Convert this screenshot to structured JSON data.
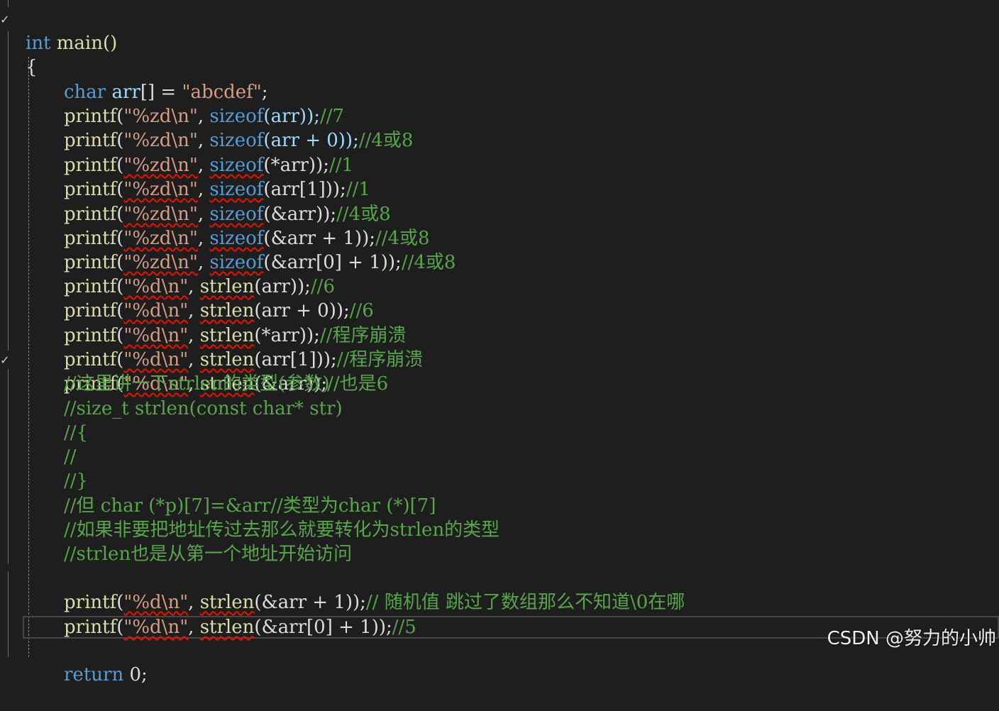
{
  "code": {
    "line_01": {
      "kw": "int",
      "rest": " main()"
    },
    "line_02": {
      "text": "{"
    },
    "line_03": {
      "kw": "char",
      "var": " arr",
      "rest": "[] = ",
      "str": "\"abcdef\"",
      "end": ";"
    },
    "line_04": {
      "fn": "printf",
      "p1": "(",
      "str": "\"%zd\\n\"",
      "p2": ", ",
      "kw": "sizeof",
      "rest": "(arr));",
      "cm": "//7"
    },
    "line_05": {
      "fn": "printf",
      "p1": "(",
      "str": "\"%zd\\n\"",
      "p2": ", ",
      "kw": "sizeof",
      "rest": "(arr + 0));",
      "cm": "//4或8"
    },
    "line_06": {
      "fn": "printf",
      "p1": "(",
      "str": "\"%zd\\n\"",
      "p2": ", ",
      "kw": "sizeof",
      "rest": "(*arr));",
      "cm": "//1"
    },
    "line_07": {
      "fn": "printf",
      "p1": "(",
      "str": "\"%zd\\n\"",
      "p2": ", ",
      "kw": "sizeof",
      "rest": "(arr[1]));",
      "cm": "//1"
    },
    "line_08": {
      "fn": "printf",
      "p1": "(",
      "str": "\"%zd\\n\"",
      "p2": ", ",
      "kw": "sizeof",
      "rest": "(&arr));",
      "cm": "//4或8"
    },
    "line_09": {
      "fn": "printf",
      "p1": "(",
      "str": "\"%zd\\n\"",
      "p2": ", ",
      "kw": "sizeof",
      "rest": "(&arr + 1));",
      "cm": "//4或8"
    },
    "line_10": {
      "fn": "printf",
      "p1": "(",
      "str": "\"%zd\\n\"",
      "p2": ", ",
      "kw": "sizeof",
      "rest": "(&arr[0] + 1));",
      "cm": "//4或8"
    },
    "line_11": {
      "fn": "printf",
      "p1": "(",
      "str": "\"%d\\n\"",
      "p2": ", ",
      "fn2": "strlen",
      "rest": "(arr));",
      "cm": "//6"
    },
    "line_12": {
      "fn": "printf",
      "p1": "(",
      "str": "\"%d\\n\"",
      "p2": ", ",
      "fn2": "strlen",
      "rest": "(arr + 0));",
      "cm": "//6"
    },
    "line_13": {
      "fn": "printf",
      "p1": "(",
      "str": "\"%d\\n\"",
      "p2": ", ",
      "fn2": "strlen",
      "rest": "(*arr));",
      "cm": "//程序崩溃"
    },
    "line_14": {
      "fn": "printf",
      "p1": "(",
      "str": "\"%d\\n\"",
      "p2": ", ",
      "fn2": "strlen",
      "rest": "(arr[1]));",
      "cm": "//程序崩溃"
    },
    "line_15": {
      "fn": "printf",
      "p1": "(",
      "str": "\"%d\\n\"",
      "p2": ", ",
      "fn2": "strlen",
      "rest": "(&arr));",
      "cm": "//也是6"
    },
    "line_16": {
      "cm": "//这里讲一下strlen的类型(参数)"
    },
    "line_17": {
      "cm": "//size_t strlen(const char* str)"
    },
    "line_18": {
      "cm": "//{"
    },
    "line_19": {
      "cm": "//"
    },
    "line_20": {
      "cm": "//}"
    },
    "line_21": {
      "cm": "//但 char (*p)[7]=&arr//类型为char (*)[7]"
    },
    "line_22": {
      "cm": "//如果非要把地址传过去那么就要转化为strlen的类型"
    },
    "line_23": {
      "cm": "//strlen也是从第一个地址开始访问"
    },
    "line_24": {
      "fn": "printf",
      "p1": "(",
      "str": "\"%d\\n\"",
      "p2": ", ",
      "fn2": "strlen",
      "rest": "(&arr + 1));",
      "cm": "// 随机值 跳过了数组那么不知道\\0在哪"
    },
    "line_25": {
      "fn": "printf",
      "p1": "(",
      "str": "\"%d\\n\"",
      "p2": ", ",
      "fn2": "strlen",
      "rest": "(&arr[0] + 1));",
      "cm": "//5"
    },
    "line_26": {
      "kw": "return",
      "rest": " 0;"
    }
  },
  "watermark": "CSDN @努力的小帅",
  "colors": {
    "background": "#1e1e1e",
    "keyword": "#569cd6",
    "function": "#dcdcaa",
    "string": "#d69d85",
    "comment": "#57a64a",
    "squiggle": "#e51400"
  },
  "icons": [
    "fold-check-icon"
  ]
}
